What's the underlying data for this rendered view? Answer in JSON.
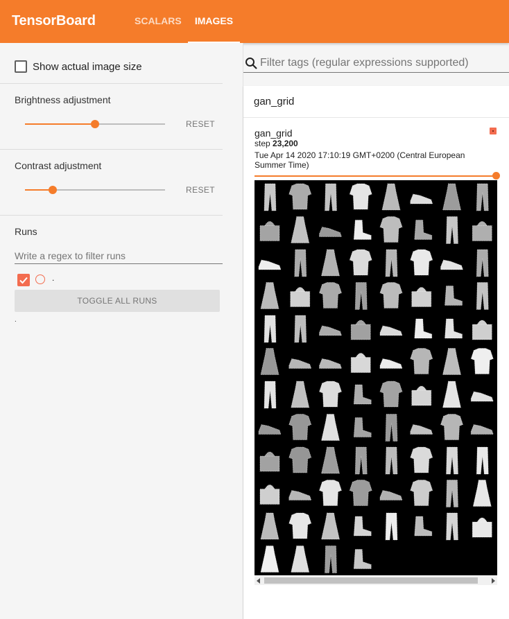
{
  "app": {
    "title": "TensorBoard"
  },
  "tabs": [
    {
      "label": "SCALARS",
      "active": false
    },
    {
      "label": "IMAGES",
      "active": true
    }
  ],
  "sidebar": {
    "show_actual_size": {
      "label": "Show actual image size",
      "checked": false
    },
    "brightness": {
      "label": "Brightness adjustment",
      "level": 0.5,
      "reset_label": "RESET"
    },
    "contrast": {
      "label": "Contrast adjustment",
      "level": 0.2,
      "reset_label": "RESET"
    },
    "runs": {
      "title": "Runs",
      "filter_placeholder": "Write a regex to filter runs",
      "items": [
        {
          "name": ".",
          "checked": true,
          "color": "#f36c4f"
        }
      ],
      "toggle_all_label": "TOGGLE ALL RUNS",
      "footnote": "."
    }
  },
  "main": {
    "filter_placeholder": "Filter tags (regular expressions supported)",
    "tag_group": {
      "name": "gan_grid",
      "card": {
        "title": "gan_grid",
        "step_label": "step",
        "step_value": "23,200",
        "timestamp": "Tue Apr 14 2020 17:10:19 GMT+0200 (Central European Summer Time)",
        "step_slider_level": 1.0
      }
    }
  },
  "colors": {
    "accent": "#f57c2a",
    "run": "#f36c4f"
  }
}
